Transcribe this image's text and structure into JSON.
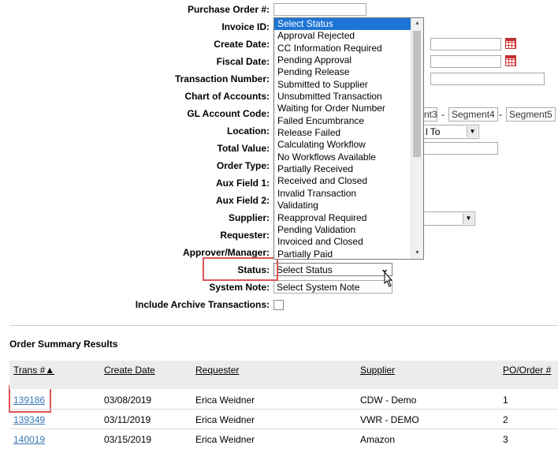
{
  "form": {
    "fields": [
      {
        "label": "Purchase Order #:"
      },
      {
        "label": "Invoice ID:"
      },
      {
        "label": "Create Date:"
      },
      {
        "label": "Fiscal Date:"
      },
      {
        "label": "Transaction Number:"
      },
      {
        "label": "Chart of Accounts:"
      },
      {
        "label": "GL Account Code:"
      },
      {
        "label": "Location:"
      },
      {
        "label": "Total Value:"
      },
      {
        "label": "Order Type:"
      },
      {
        "label": "Aux Field 1:"
      },
      {
        "label": "Aux Field 2:"
      },
      {
        "label": "Supplier:"
      },
      {
        "label": "Requester:"
      },
      {
        "label": "Approver/Manager:"
      },
      {
        "label": "Status:"
      },
      {
        "label": "System Note:"
      },
      {
        "label": "Include Archive Transactions:"
      }
    ],
    "gl_segments": [
      "nt3",
      "Segment4",
      "Segment5"
    ],
    "location_select_partial": "l To",
    "status_selected": "Select Status",
    "system_note_selected": "Select System Note"
  },
  "status_options": [
    "Select Status",
    "Approval Rejected",
    "CC Information Required",
    "Pending Approval",
    "Pending Release",
    "Submitted to Supplier",
    "Unsubmitted Transaction",
    "Waiting for Order Number",
    "Failed Encumbrance",
    "Release Failed",
    "Calculating Workflow",
    "No Workflows Available",
    "Partially Received",
    "Received and Closed",
    "Invalid Transaction",
    "Validating",
    "Reapproval Required",
    "Pending Validation",
    "Invoiced and Closed",
    "Partially Paid"
  ],
  "results": {
    "title": "Order Summary Results",
    "headers": [
      "Trans #▲",
      "Create Date",
      "Requester",
      "Supplier",
      "PO/Order #"
    ],
    "rows": [
      [
        "139186",
        "03/08/2019",
        "Erica Weidner",
        "CDW - Demo",
        "1"
      ],
      [
        "139349",
        "03/11/2019",
        "Erica Weidner",
        "VWR - DEMO",
        "2"
      ],
      [
        "140019",
        "03/15/2019",
        "Erica Weidner",
        "Amazon",
        "3"
      ]
    ]
  },
  "colors": {
    "highlight_box": "#e05555",
    "selected_option": "#1e74d6",
    "link": "#3a7ab5"
  }
}
